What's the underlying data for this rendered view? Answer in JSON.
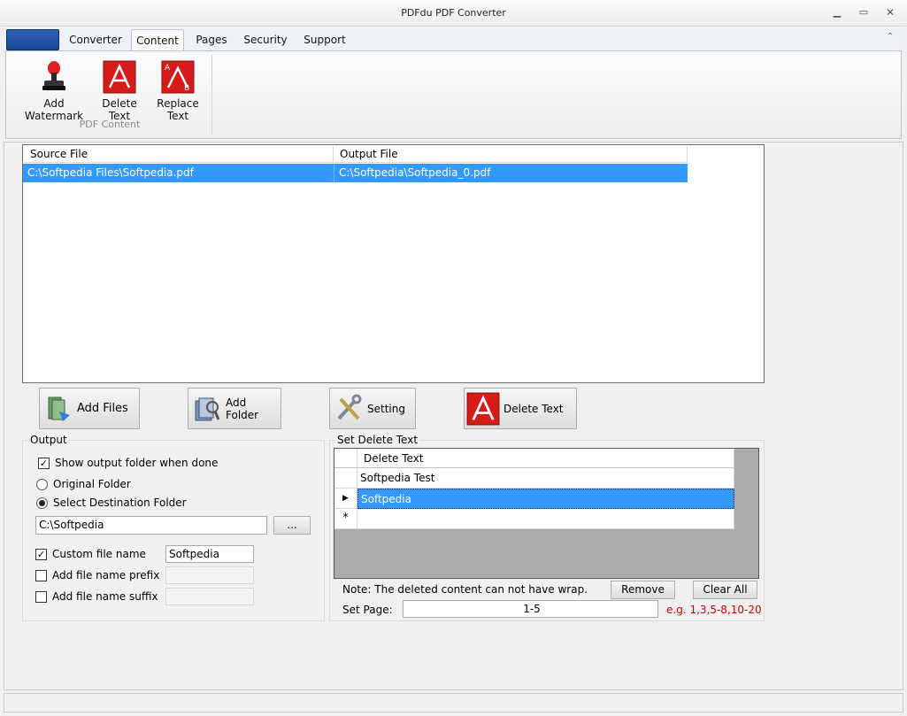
{
  "window": {
    "title": "PDFdu PDF Converter"
  },
  "ribbon": {
    "tabs": [
      "Converter",
      "Content",
      "Pages",
      "Security",
      "Support"
    ],
    "active_tab": "Content",
    "buttons": [
      "Add Watermark",
      "Delete Text",
      "Replace Text"
    ],
    "group_label": "PDF Content"
  },
  "file_list": {
    "columns": [
      "Source File",
      "Output File"
    ],
    "rows": [
      [
        "C:\\Softpedia Files\\Softpedia.pdf",
        "C:\\Softpedia\\Softpedia_0.pdf"
      ]
    ]
  },
  "actions": {
    "add_files": "Add Files",
    "add_folder": "Add Folder",
    "setting": "Setting",
    "delete_text": "Delete Text"
  },
  "output": {
    "title": "Output",
    "show_folder": "Show output folder when done",
    "original_folder": "Original Folder",
    "select_destination": "Select Destination Folder",
    "destination_path": "C:\\Softpedia",
    "browse": "...",
    "custom_name": "Custom file name",
    "custom_name_value": "Softpedia",
    "prefix": "Add file name prefix",
    "suffix": "Add file name suffix"
  },
  "delete_panel": {
    "title": "Set Delete Text",
    "column": "Delete Text",
    "rows": [
      "Softpedia Test",
      "Softpedia"
    ],
    "new_row_marker": "*",
    "note": "Note: The deleted content can not have wrap.",
    "remove": "Remove",
    "clear_all": "Clear All",
    "set_page_label": "Set Page:",
    "set_page_value": "1-5",
    "example": "e.g. 1,3,5-8,10-20"
  },
  "colors": {
    "selection": "#3399ff",
    "hint": "#cc0000"
  }
}
